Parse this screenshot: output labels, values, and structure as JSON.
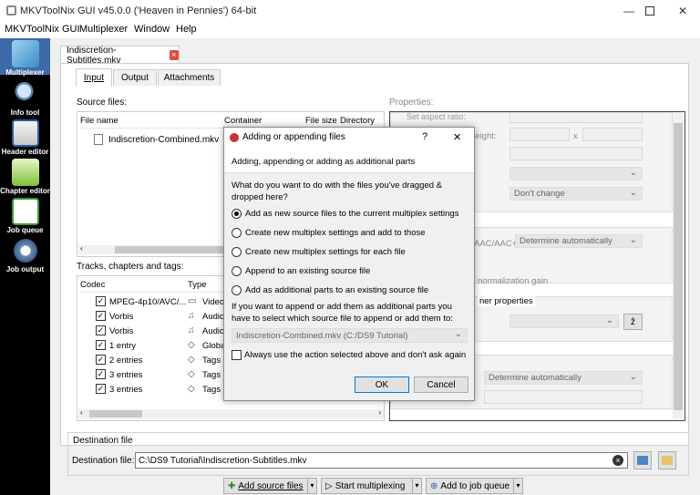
{
  "window": {
    "title": "MKVToolNix GUI v45.0.0 ('Heaven in Pennies') 64-bit"
  },
  "menubar": [
    "MKVToolNix GUI",
    "Multiplexer",
    "Window",
    "Help"
  ],
  "sidebar": [
    {
      "label": "Multiplexer",
      "icon": "multiplexer-icon"
    },
    {
      "label": "Info tool",
      "icon": "info-tool-icon"
    },
    {
      "label": "Header editor",
      "icon": "header-editor-icon"
    },
    {
      "label": "Chapter editor",
      "icon": "chapter-editor-icon"
    },
    {
      "label": "Job queue",
      "icon": "job-queue-icon"
    },
    {
      "label": "Job output",
      "icon": "job-output-icon"
    }
  ],
  "file_tab": "Indiscretion-Subtitles.mkv",
  "subtabs": [
    "Input",
    "Output",
    "Attachments"
  ],
  "source_files": {
    "label": "Source files:",
    "headers": [
      "File name",
      "Container",
      "File size",
      "Directory"
    ],
    "rows": [
      "Indiscretion-Combined.mkv"
    ]
  },
  "tracks": {
    "label": "Tracks, chapters and tags:",
    "headers": [
      "Codec",
      "Type"
    ],
    "rows": [
      {
        "codec": "MPEG-4p10/AVC/...",
        "type": "Video"
      },
      {
        "codec": "Vorbis",
        "type": "Audio"
      },
      {
        "codec": "Vorbis",
        "type": "Audio"
      },
      {
        "codec": "1 entry",
        "type": "Global"
      },
      {
        "codec": "2 entries",
        "type": "Tags"
      },
      {
        "codec": "3 entries",
        "type": "Tags"
      },
      {
        "codec": "3 entries",
        "type": "Tags"
      }
    ]
  },
  "properties": {
    "label": "Properties:",
    "set_aspect_ratio": "Set aspect ratio:",
    "height_label": "height:",
    "x_sep": "x",
    "dont_change": "Don't change",
    "aac_label": "AAC/AAC+:",
    "aac_value": "Determine automatically",
    "normalization_gain": "normalization gain",
    "container_properties": "ner properties",
    "sort_icon_label": "ẑ",
    "determine": "Determine automatically"
  },
  "destination": {
    "group_label": "Destination file",
    "label": "Destination file:",
    "value": "C:\\DS9 Tutorial\\Indiscretion-Subtitles.mkv"
  },
  "bottom_buttons": [
    "Add source files",
    "Start multiplexing",
    "Add to job queue"
  ],
  "dialog": {
    "title": "Adding or appending files",
    "help": "?",
    "close": "✕",
    "header": "Adding, appending or adding as additional parts",
    "question": "What do you want to do with the files you've dragged & dropped here?",
    "options": [
      "Add as new source files to the current multiplex settings",
      "Create new multiplex settings and add to those",
      "Create new multiplex settings for each file",
      "Append to an existing source file",
      "Add as additional parts to an existing source file"
    ],
    "selected_index": 0,
    "append_note": "If you want to append or add them as additional parts you have to select which source file to append or add them to:",
    "source_select": "Indiscretion-Combined.mkv (C:/DS9 Tutorial)",
    "always_use": "Always use the action selected above and don't ask again",
    "ok": "OK",
    "cancel": "Cancel"
  },
  "colors": {
    "accent": "#0078d7",
    "sidebar_bg": "#000000",
    "sidebar_active": "#3c6aa8",
    "close_red": "#e04c3c"
  }
}
